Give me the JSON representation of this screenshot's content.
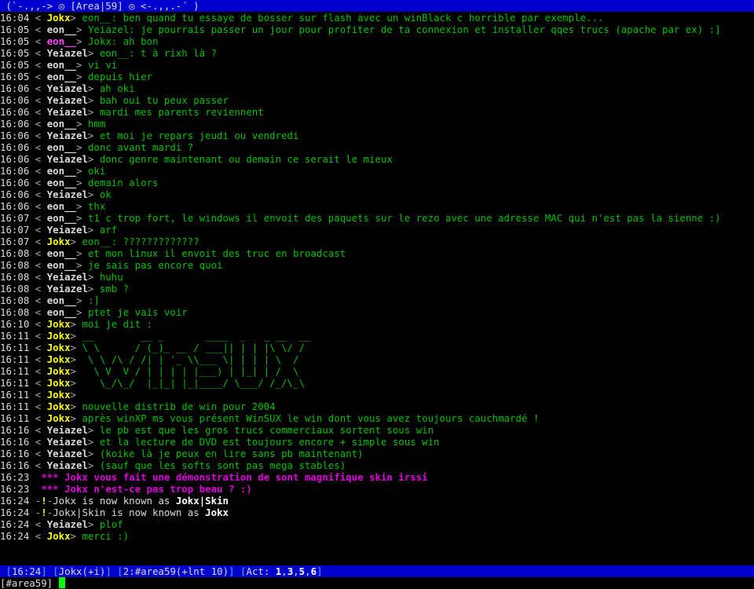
{
  "window": {
    "topic": " (`-.,,-> ◎ [Area|59] ◎ <-.,,.-´ )"
  },
  "lines": [
    {
      "t": "16:04",
      "n": "Jokx",
      "k": "j",
      "m": "eon__: ben quand tu essaye de bosser sur flash avec un winBlack c horrible par exemple..."
    },
    {
      "t": "16:05",
      "n": "eon__",
      "k": "e",
      "m": "Yeiazel: je pourrais passer un jour pour profiter de ta connexion et installer qqes trucs (apache par ex) :]"
    },
    {
      "t": "16:05",
      "n": "eon__",
      "k": "eh",
      "m": "Jokx: ah bon"
    },
    {
      "t": "16:05",
      "n": "Yeiazel",
      "k": "y",
      "m": "eon__: t à rixh là ?"
    },
    {
      "t": "16:05",
      "n": "eon__",
      "k": "e",
      "m": "vi vi"
    },
    {
      "t": "16:05",
      "n": "eon__",
      "k": "e",
      "m": "depuis hier"
    },
    {
      "t": "16:06",
      "n": "Yeiazel",
      "k": "y",
      "m": "ah oki"
    },
    {
      "t": "16:06",
      "n": "Yeiazel",
      "k": "y",
      "m": "bah oui tu peux passer"
    },
    {
      "t": "16:06",
      "n": "Yeiazel",
      "k": "y",
      "m": "mardi mes parents reviennent"
    },
    {
      "t": "16:06",
      "n": "eon__",
      "k": "e",
      "m": "hmm"
    },
    {
      "t": "16:06",
      "n": "Yeiazel",
      "k": "y",
      "m": "et moi je repars jeudi ou vendredi"
    },
    {
      "t": "16:06",
      "n": "eon__",
      "k": "e",
      "m": "donc avant mardi ?"
    },
    {
      "t": "16:06",
      "n": "Yeiazel",
      "k": "y",
      "m": "donc genre maintenant ou demain ce serait le mieux"
    },
    {
      "t": "16:06",
      "n": "eon__",
      "k": "e",
      "m": "oki"
    },
    {
      "t": "16:06",
      "n": "eon__",
      "k": "e",
      "m": "demain alors"
    },
    {
      "t": "16:06",
      "n": "Yeiazel",
      "k": "y",
      "m": "ok"
    },
    {
      "t": "16:06",
      "n": "eon__",
      "k": "e",
      "m": "thx"
    },
    {
      "t": "16:07",
      "n": "eon__",
      "k": "e",
      "m": "t1 c trop fort, le windows il envoit des paquets sur le rezo avec une adresse MAC qui n'est pas la sienne :)"
    },
    {
      "t": "16:07",
      "n": "Yeiazel",
      "k": "y",
      "m": "arf"
    },
    {
      "t": "16:07",
      "n": "Jokx",
      "k": "j",
      "m": "eon__: ?????????????"
    },
    {
      "t": "16:08",
      "n": "eon__",
      "k": "e",
      "m": "et mon linux il envoit des truc en broadcast"
    },
    {
      "t": "16:08",
      "n": "eon__",
      "k": "e",
      "m": "je sais pas encore quoi"
    },
    {
      "t": "16:08",
      "n": "Yeiazel",
      "k": "y",
      "m": "huhu"
    },
    {
      "t": "16:08",
      "n": "Yeiazel",
      "k": "y",
      "m": "smb ?"
    },
    {
      "t": "16:08",
      "n": "eon__",
      "k": "e",
      "m": ":]"
    },
    {
      "t": "16:08",
      "n": "eon__",
      "k": "e",
      "m": "ptet je vais voir"
    },
    {
      "t": "16:10",
      "n": "Jokx",
      "k": "j",
      "m": "moi je dit :"
    },
    {
      "t": "16:11",
      "n": "Jokx",
      "k": "j",
      "m": "__        __ _       ____  _   _ __  __"
    },
    {
      "t": "16:11",
      "n": "Jokx",
      "k": "j",
      "m": "\\ \\      / (_)_ __ / ___|| | | |\\ \\/ /"
    },
    {
      "t": "16:11",
      "n": "Jokx",
      "k": "j",
      "m": " \\ \\ /\\ / /| | '_ \\\\___ \\| | | | \\  / "
    },
    {
      "t": "16:11",
      "n": "Jokx",
      "k": "j",
      "m": "  \\ V  V / | | | | |___) | |_| | /  \\ "
    },
    {
      "t": "16:11",
      "n": "Jokx",
      "k": "j",
      "m": "   \\_/\\_/  |_|_| |_|____/ \\___/ /_/\\_\\"
    },
    {
      "t": "16:11",
      "n": "Jokx",
      "k": "j",
      "m": ""
    },
    {
      "t": "16:11",
      "n": "Jokx",
      "k": "j",
      "m": "nouvelle distrib de win pour 2004"
    },
    {
      "t": "16:11",
      "n": "Jokx",
      "k": "j",
      "m": "après winXP ms vous présent WinSUX le win dont vous avez toujours cauchmardé !"
    },
    {
      "t": "16:16",
      "n": "Yeiazel",
      "k": "y",
      "m": "le pb est que les gros trucs commerciaux sortent sous win"
    },
    {
      "t": "16:16",
      "n": "Yeiazel",
      "k": "y",
      "m": "et la lecture de DVD est toujours encore + simple sous win"
    },
    {
      "t": "16:16",
      "n": "Yeiazel",
      "k": "y",
      "m": "(koike là je peux en lire sans pb maintenant)"
    },
    {
      "t": "16:16",
      "n": "Yeiazel",
      "k": "y",
      "m": "(sauf que les softs sont pas mega stables)"
    },
    {
      "t": "16:23",
      "type": "action",
      "m": "Jokx vous fait une démonstration de sont magnifique skin irssi"
    },
    {
      "t": "16:23",
      "type": "action",
      "m": "Jokx n'est-ce pas trop beau ? :)"
    },
    {
      "t": "16:24",
      "type": "nickchange",
      "a": "Jokx",
      "b": "Jokx|Skin",
      "mid": " is now known as "
    },
    {
      "t": "16:24",
      "type": "nickchange",
      "a": "Jokx|Skin",
      "b": "Jokx",
      "mid": " is now known as "
    },
    {
      "t": "16:24",
      "n": "Yeiazel",
      "k": "y",
      "m": "plof"
    },
    {
      "t": "16:24",
      "n": "Jokx",
      "k": "j",
      "m": "merci :)"
    }
  ],
  "status": {
    "time": "16:24",
    "nick": "Jokx",
    "mode": "+i",
    "win_num": "2",
    "channel": "#area59",
    "chmode": "+lnt 10",
    "act_label": "Act: ",
    "act": [
      "1",
      "3",
      "5",
      "6"
    ]
  },
  "input": {
    "prompt": "[#area59] "
  }
}
